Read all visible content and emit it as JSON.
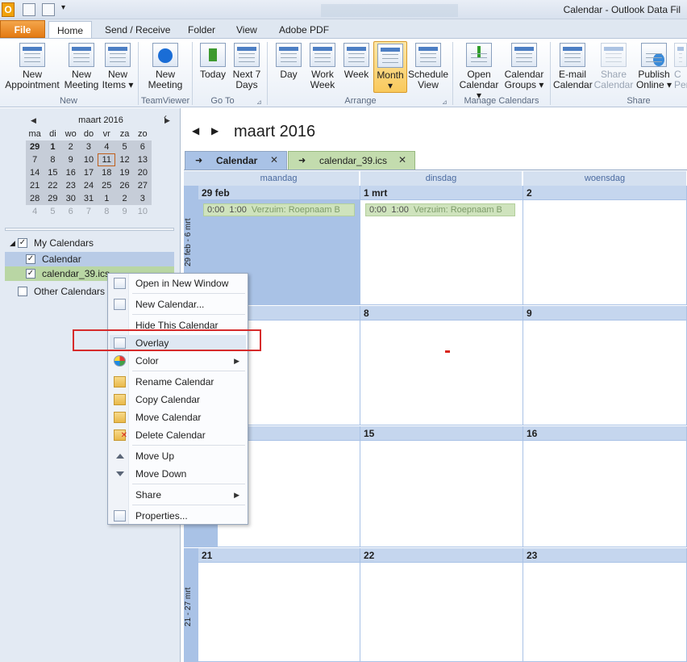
{
  "window": {
    "title": "Calendar - Outlook Data Fil",
    "app_icon": "O"
  },
  "ribbon_tabs": [
    "File",
    "Home",
    "Send / Receive",
    "Folder",
    "View",
    "Adobe PDF"
  ],
  "ribbon": {
    "groups": [
      {
        "label": "New",
        "buttons": [
          {
            "line1": "New",
            "line2": "Appointment"
          },
          {
            "line1": "New",
            "line2": "Meeting"
          },
          {
            "line1": "New",
            "line2": "Items ▾"
          }
        ]
      },
      {
        "label": "TeamViewer",
        "buttons": [
          {
            "line1": "New",
            "line2": "Meeting"
          }
        ]
      },
      {
        "label": "Go To",
        "buttons": [
          {
            "line1": "Today",
            "line2": ""
          },
          {
            "line1": "Next 7",
            "line2": "Days"
          }
        ]
      },
      {
        "label": "Arrange",
        "buttons": [
          {
            "line1": "Day",
            "line2": ""
          },
          {
            "line1": "Work",
            "line2": "Week"
          },
          {
            "line1": "Week",
            "line2": ""
          },
          {
            "line1": "Month",
            "line2": "▾"
          },
          {
            "line1": "Schedule",
            "line2": "View"
          }
        ]
      },
      {
        "label": "Manage Calendars",
        "buttons": [
          {
            "line1": "Open",
            "line2": "Calendar ▾"
          },
          {
            "line1": "Calendar",
            "line2": "Groups ▾"
          }
        ]
      },
      {
        "label": "Share",
        "buttons": [
          {
            "line1": "E-mail",
            "line2": "Calendar"
          },
          {
            "line1": "Share",
            "line2": "Calendar"
          },
          {
            "line1": "Publish",
            "line2": "Online ▾"
          },
          {
            "line1": "C",
            "line2": "Per"
          }
        ]
      }
    ]
  },
  "mini_calendar": {
    "month": "maart 2016",
    "weekdays": [
      "ma",
      "di",
      "wo",
      "do",
      "vr",
      "za",
      "zo"
    ],
    "weeks": [
      [
        "29",
        "1",
        "2",
        "3",
        "4",
        "5",
        "6"
      ],
      [
        "7",
        "8",
        "9",
        "10",
        "11",
        "12",
        "13"
      ],
      [
        "14",
        "15",
        "16",
        "17",
        "18",
        "19",
        "20"
      ],
      [
        "21",
        "22",
        "23",
        "24",
        "25",
        "26",
        "27"
      ],
      [
        "28",
        "29",
        "30",
        "31",
        "1",
        "2",
        "3"
      ],
      [
        "4",
        "5",
        "6",
        "7",
        "8",
        "9",
        "10"
      ]
    ]
  },
  "tree": {
    "my_calendars": "My Calendars",
    "calendar": "Calendar",
    "ics": "calendar_39.ics",
    "other": "Other Calendars",
    "check": "✓"
  },
  "main": {
    "title": "maart 2016",
    "tabs": [
      "Calendar",
      "calendar_39.ics"
    ],
    "day_headers": [
      "maandag",
      "dinsdag",
      "woensdag"
    ],
    "weeks": [
      {
        "label": "29 feb - 6 mrt",
        "days": [
          "29 feb",
          "1 mrt",
          "2"
        ]
      },
      {
        "label": "",
        "days": [
          "",
          "8",
          "9"
        ]
      },
      {
        "label": "",
        "days": [
          "",
          "15",
          "16"
        ]
      },
      {
        "label": "21 - 27 mrt",
        "days": [
          "21",
          "22",
          "23"
        ]
      }
    ],
    "event": {
      "start": "0:00",
      "end": "1:00",
      "subject": "Verzuim: Roepnaam B"
    }
  },
  "context_menu": [
    "Open in New Window",
    "New Calendar...",
    "Hide This Calendar",
    "Overlay",
    "Color",
    "Rename Calendar",
    "Copy Calendar",
    "Move Calendar",
    "Delete Calendar",
    "Move Up",
    "Move Down",
    "Share",
    "Properties..."
  ],
  "colors": {
    "accent": "#a9c2e6",
    "ics": "#c3dcae",
    "highlight": "#d62b2b"
  }
}
